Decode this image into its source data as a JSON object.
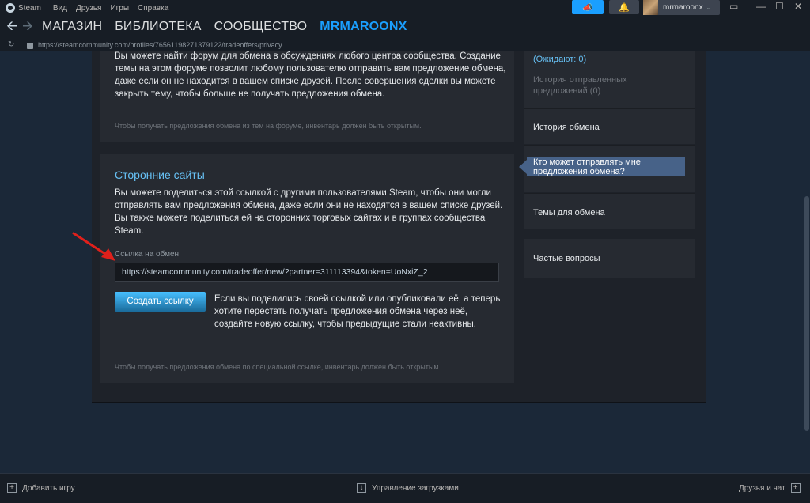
{
  "menubar": {
    "app_name": "Steam",
    "items": [
      "Вид",
      "Друзья",
      "Игры",
      "Справка"
    ],
    "username": "mrmaroonx"
  },
  "nav": {
    "links": [
      "МАГАЗИН",
      "БИБЛИОТЕКА",
      "СООБЩЕСТВО",
      "MRMAROONX"
    ]
  },
  "url": "https://steamcommunity.com/profiles/76561198271379122/tradeoffers/privacy",
  "forum_panel": {
    "text_line1": "Вы можете найти форум для обмена в обсуждениях любого центра сообщества. Создание",
    "text_line2": "темы на этом форуме позволит любому пользователю отправить вам предложение обмена,",
    "text_line3": "даже если он не находится в вашем списке друзей. После совершения сделки вы можете",
    "text_line4": "закрыть тему, чтобы больше не получать предложения обмена.",
    "note": "Чтобы получать предложения обмена из тем на форуме, инвентарь должен быть открытым."
  },
  "third_party_panel": {
    "title": "Сторонние сайты",
    "text_line1": "Вы можете поделиться этой ссылкой с другими пользователями Steam, чтобы они могли",
    "text_line2": "отправлять вам предложения обмена, даже если они не находятся в вашем списке друзей.",
    "text_line3": "Вы также можете поделиться ей на сторонних торговых сайтах и в группах сообщества",
    "text_line4": "Steam.",
    "link_label": "Ссылка на обмен",
    "link_value": "https://steamcommunity.com/tradeoffer/new/?partner=311113394&token=UoNxiZ_2",
    "button_label": "Создать ссылку",
    "button_desc_line1": "Если вы поделились своей ссылкой или опубликовали её, а теперь",
    "button_desc_line2": "хотите перестать получать предложения обмена через неё,",
    "button_desc_line3": "создайте новую ссылку, чтобы предыдущие стали неактивны.",
    "note": "Чтобы получать предложения обмена по специальной ссылке, инвентарь должен быть открытым."
  },
  "sidebar": {
    "waiting": "(Ожидают: 0)",
    "sent_history_line1": "История отправленных",
    "sent_history_line2": "предложений (0)",
    "trade_history": "История обмена",
    "who_can_send_line1": "Кто может отправлять мне",
    "who_can_send_line2": "предложения обмена?",
    "trade_topics": "Темы для обмена",
    "faq": "Частые вопросы"
  },
  "bottombar": {
    "add_game": "Добавить игру",
    "downloads": "Управление загрузками",
    "friends_chat": "Друзья и чат"
  },
  "colors": {
    "accent": "#1a9fff",
    "link_blue": "#67c1f5",
    "sidebar_active": "#476288",
    "annotation_red": "#e0201b"
  }
}
